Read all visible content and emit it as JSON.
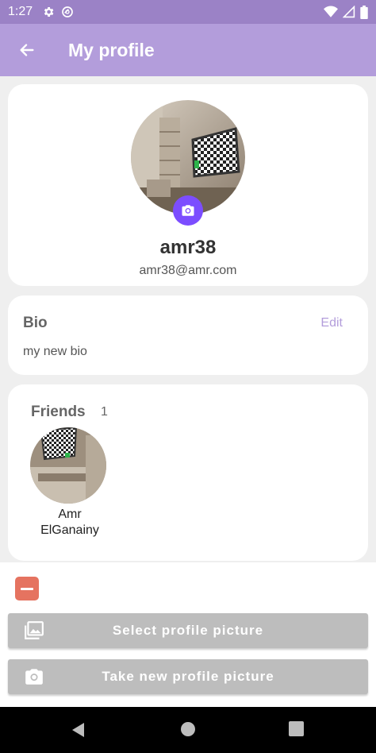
{
  "status_bar": {
    "time": "1:27"
  },
  "app_bar": {
    "title": "My profile"
  },
  "profile": {
    "username": "amr38",
    "email": "amr38@amr.com"
  },
  "bio": {
    "title": "Bio",
    "edit_label": "Edit",
    "text": "my new bio"
  },
  "friends": {
    "title": "Friends",
    "count": "1",
    "items": [
      {
        "name": "Amr ElGanainy"
      }
    ]
  },
  "sheet": {
    "select_label": "Select profile picture",
    "take_label": "Take new profile picture"
  },
  "colors": {
    "status_bar": "#9b82c6",
    "app_bar": "#b39ddb",
    "accent": "#7c4dff",
    "close_button": "#e57360",
    "sheet_button": "#bdbdbd"
  },
  "icons": [
    "settings-icon",
    "no-disturb-icon",
    "wifi-icon",
    "signal-icon",
    "battery-icon",
    "back-arrow-icon",
    "camera-icon",
    "gallery-icon",
    "minus-icon",
    "nav-back-icon",
    "nav-home-icon",
    "nav-recents-icon"
  ]
}
